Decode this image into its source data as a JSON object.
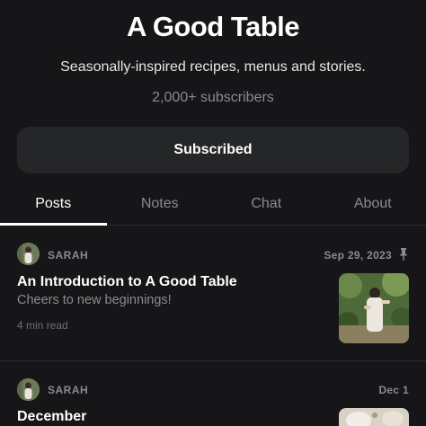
{
  "publication": {
    "title": "A Good Table",
    "description": "Seasonally-inspired recipes, menus and stories.",
    "subscribers": "2,000+ subscribers"
  },
  "subscribe_button": {
    "label": "Subscribed"
  },
  "tabs": [
    {
      "label": "Posts",
      "active": true
    },
    {
      "label": "Notes",
      "active": false
    },
    {
      "label": "Chat",
      "active": false
    },
    {
      "label": "About",
      "active": false
    }
  ],
  "posts": [
    {
      "author": "SARAH",
      "date": "Sep 29, 2023",
      "pinned": true,
      "pin_icon": "pin-icon",
      "title": "An Introduction to A Good Table",
      "subtitle": "Cheers to new beginnings!",
      "read_time": "4 min read"
    },
    {
      "author": "SARAH",
      "date": "Dec 1",
      "pinned": false,
      "title": "December"
    }
  ],
  "colors": {
    "background": "#161618",
    "button_bg": "#252627",
    "muted_text": "#8b8b8e",
    "divider": "#2c2c2e"
  }
}
